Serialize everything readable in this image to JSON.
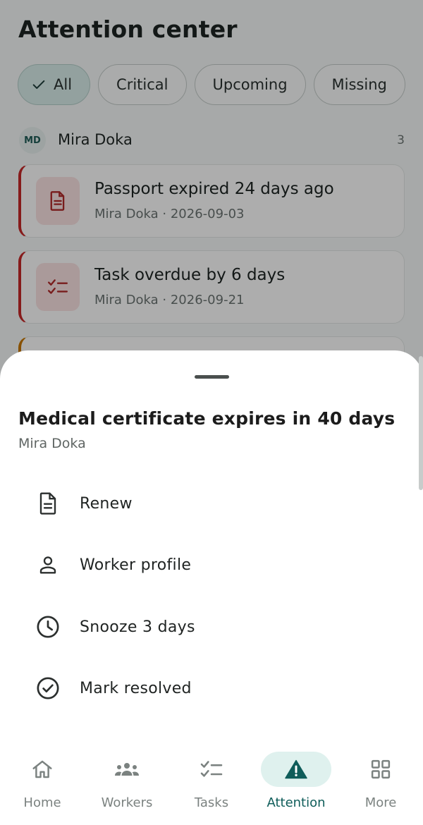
{
  "page": {
    "title": "Attention center"
  },
  "filters": [
    {
      "label": "All",
      "selected": true
    },
    {
      "label": "Critical",
      "selected": false
    },
    {
      "label": "Upcoming",
      "selected": false
    },
    {
      "label": "Missing",
      "selected": false
    }
  ],
  "group": {
    "initials": "MD",
    "name": "Mira Doka",
    "count": "3"
  },
  "items": [
    {
      "title": "Passport expired 24 days ago",
      "subtitle": "Mira Doka · 2026-09-03",
      "icon": "document-icon",
      "severity_color": "#c62828"
    },
    {
      "title": "Task overdue by 6 days",
      "subtitle": "Mira Doka · 2026-09-21",
      "icon": "checklist-icon",
      "severity_color": "#c62828"
    }
  ],
  "sheet": {
    "title": "Medical certificate expires in 40 days",
    "subtitle": "Mira Doka",
    "actions": [
      {
        "label": "Renew",
        "icon": "document-icon"
      },
      {
        "label": "Worker profile",
        "icon": "person-icon"
      },
      {
        "label": "Snooze 3 days",
        "icon": "clock-icon"
      },
      {
        "label": "Mark resolved",
        "icon": "check-circle-icon"
      }
    ]
  },
  "nav": [
    {
      "label": "Home",
      "icon": "home-icon",
      "active": false
    },
    {
      "label": "Workers",
      "icon": "people-icon",
      "active": false
    },
    {
      "label": "Tasks",
      "icon": "checklist-icon",
      "active": false
    },
    {
      "label": "Attention",
      "icon": "warning-icon",
      "active": true
    },
    {
      "label": "More",
      "icon": "grid-icon",
      "active": false
    }
  ],
  "colors": {
    "accent": "#0f5d5a",
    "critical": "#c62828",
    "warning": "#c77700",
    "scrim": "rgba(0,0,0,0.32)"
  }
}
